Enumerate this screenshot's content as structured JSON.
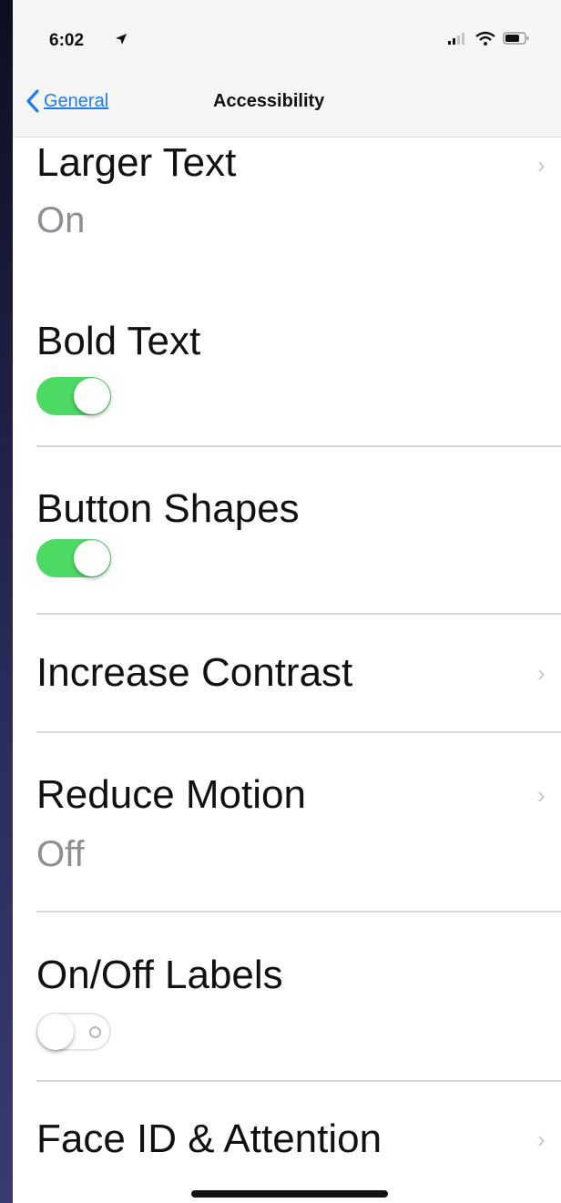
{
  "status_bar": {
    "time": "6:02"
  },
  "nav": {
    "back_label": "General",
    "title": "Accessibility"
  },
  "rows": {
    "larger_text": {
      "title": "Larger Text",
      "value": "On"
    },
    "bold_text": {
      "title": "Bold Text",
      "toggle": "on"
    },
    "button_shapes": {
      "title": "Button Shapes",
      "toggle": "on"
    },
    "increase_contrast": {
      "title": "Increase Contrast"
    },
    "reduce_motion": {
      "title": "Reduce Motion",
      "value": "Off"
    },
    "on_off_labels": {
      "title": "On/Off Labels",
      "toggle": "off"
    },
    "face_id": {
      "title": "Face ID & Attention"
    }
  },
  "colors": {
    "toggle_on": "#4cd964",
    "link_blue": "#1f7cf6",
    "secondary_text": "#8e8e93",
    "separator": "#d8d8dc"
  },
  "icons": [
    "location-arrow-icon",
    "cellular-signal-icon",
    "wifi-icon",
    "battery-icon",
    "chevron-left-icon",
    "chevron-right-icon"
  ]
}
